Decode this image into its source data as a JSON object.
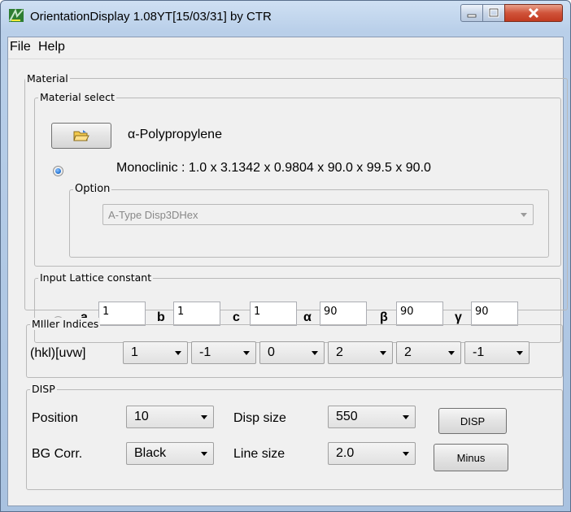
{
  "window": {
    "title": "OrientationDisplay 1.08YT[15/03/31] by CTR"
  },
  "menu": [
    "File",
    "Help"
  ],
  "material": {
    "legend": "Material",
    "select_legend": "Material select",
    "name": "α-Polypropylene",
    "lattice_info": "Monoclinic : 1.0 x 3.1342 x 0.9804 x 90.0 x 99.5 x 90.0",
    "option_legend": "Option",
    "option_value": "A-Type  Disp3DHex",
    "radio_selected": true
  },
  "lattice": {
    "legend": "Input Lattice constant",
    "radio_selected": false,
    "fields": [
      {
        "label": "a",
        "value": "1"
      },
      {
        "label": "b",
        "value": "1"
      },
      {
        "label": "c",
        "value": "1"
      },
      {
        "label": "α",
        "value": "90"
      },
      {
        "label": "β",
        "value": "90"
      },
      {
        "label": "γ",
        "value": "90"
      }
    ]
  },
  "miller": {
    "legend": "MIller Indices",
    "label": "(hkl)[uvw]",
    "values": [
      "1",
      "-1",
      "0",
      "2",
      "2",
      "-1"
    ]
  },
  "disp": {
    "legend": "DISP",
    "position_label": "Position",
    "position_value": "10",
    "disp_size_label": "Disp size",
    "disp_size_value": "550",
    "disp_button": "DISP",
    "bg_label": "BG Corr.",
    "bg_value": "Black",
    "line_size_label": "Line size",
    "line_size_value": "2.0",
    "minus_button": "Minus"
  }
}
